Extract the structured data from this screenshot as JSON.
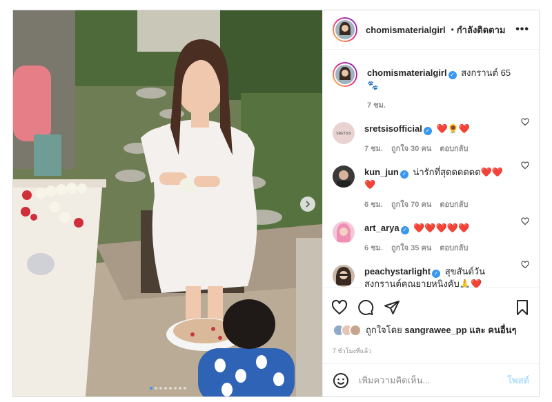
{
  "post": {
    "author": "chomismaterialgirl",
    "follow_separator": "•",
    "follow_status": "กำลังติดตาม",
    "more_label": "•••",
    "media": {
      "image_name": "songkran-foot-washing-photo",
      "slide_count": 8,
      "active_slide": 1
    }
  },
  "caption": {
    "username": "chomismaterialgirl",
    "text": "สงกรานต์ 65 🐾",
    "time": "7 ชม."
  },
  "comments": [
    {
      "username": "sretsisofficial",
      "verified": true,
      "text": "❤️🌻❤️",
      "time": "7 ชม.",
      "likes": "ถูกใจ 30 คน",
      "reply": "ตอบกลับ"
    },
    {
      "username": "kun_jun",
      "verified": true,
      "text": "น่ารักที่สุดดดดดด❤️❤️ ❤️",
      "time": "6 ชม.",
      "likes": "ถูกใจ 70 คน",
      "reply": "ตอบกลับ"
    },
    {
      "username": "art_arya",
      "verified": true,
      "text": "❤️❤️❤️❤️❤️",
      "time": "6 ชม.",
      "likes": "ถูกใจ 35 คน",
      "reply": "ตอบกลับ"
    },
    {
      "username": "peachystarlight",
      "verified": true,
      "text": "สุขสันต์วันสงกรานต์คุณยายหนิงคับ🙏❤️",
      "time": "",
      "likes": "",
      "reply": ""
    }
  ],
  "likes": {
    "prefix": "ถูกใจโดย",
    "user": "sangrawee_pp",
    "connector": "และ",
    "others": "คนอื่นๆ"
  },
  "timestamp": "7 ชั่วโมงที่แล้ว",
  "add_comment": {
    "placeholder": "เพิ่มความคิดเห็น...",
    "post_label": "โพสต์"
  },
  "colors": {
    "accent": "#3897f0",
    "heart": "#e0144a",
    "post_disabled": "#b2dffc"
  }
}
